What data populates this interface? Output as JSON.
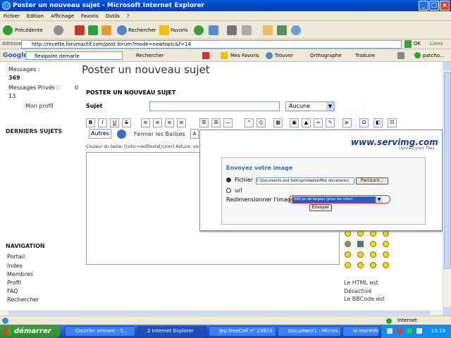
{
  "window": {
    "title": "Poster un nouveau sujet - Microsoft Internet Explorer"
  },
  "menu": [
    "Fichier",
    "Edition",
    "Affichage",
    "Favoris",
    "Outils",
    "?"
  ],
  "toolbar": {
    "back": "Précédente",
    "search": "Rechercher",
    "favorites": "Favoris"
  },
  "address": {
    "label": "Adresse",
    "url": "http://recette.forumactif.com/post.forum?mode=newtopic&f=14",
    "go": "OK",
    "links": "Liens"
  },
  "google": {
    "logo": "Google",
    "query": "flexipoint demarle",
    "search": "Rechercher",
    "favorites": "Mes Favoris",
    "find": "Trouver",
    "spell": "Orthographe",
    "translate": "Traduire",
    "user": "patcho..."
  },
  "sidebar": {
    "messages_label": "Messages :",
    "messages_value": "369",
    "private_label": "Messages Privés :",
    "private_value": "0",
    "private_count": "13",
    "profile": "Mon profil",
    "last_topics": "DERNIERS SUJETS",
    "navigation": "NAVIGATION",
    "nav_items": [
      "Portail",
      "Index",
      "Membres",
      "Profil",
      "FAQ",
      "Rechercher"
    ]
  },
  "main": {
    "page_title": "Poster un nouveau sujet",
    "section_title": "POSTER UN NOUVEAU SUJET",
    "subject_label": "Sujet",
    "subject_select": "Aucune",
    "autres": "Autres",
    "close_tags": "Fermer les Balises",
    "hint": "Couleur du texte: [color=red]texte[/color] Astuce: vous pouvez aussi utiliser color=#FF0000",
    "html_status": "Le HTML est Désactivé",
    "bbcode_status": "Le BBCode est"
  },
  "upload": {
    "brand": "www.servimg.com",
    "tagline": "Upload your files",
    "heading": "Envoyez votre image",
    "file_option": "Fichier",
    "file_path": "C:\\Documents and Settings\\stephie\\Mes documents\\",
    "browse": "Parcourir...",
    "url_option": "url",
    "resize_label": "Redimensionner l'image",
    "resize_value": "640 px de largeur (pour les sites)",
    "send": "Envoyer"
  },
  "status": {
    "zone": "Internet"
  },
  "taskbar": {
    "start": "démarrer",
    "tasks": [
      "Courrier entrant - T...",
      "2 Internet Explorer",
      "Jeu FreeCell n° 23919",
      "Document1 - Micros...",
      "la marmite"
    ],
    "clock": "13:19"
  }
}
